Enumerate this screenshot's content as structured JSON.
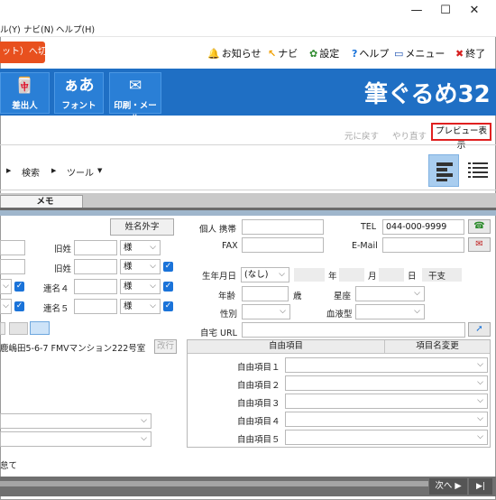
{
  "window": {
    "minimize": "—",
    "maximize": "☐",
    "close": "✕"
  },
  "menu": {
    "items": [
      "ル(Y)",
      "ナビ(N)",
      "ヘルプ(H)"
    ]
  },
  "toolbar": {
    "switch_button": "ット）へ切替",
    "links": [
      {
        "icon": "🔔",
        "label": "お知らせ"
      },
      {
        "icon": "↖",
        "label": "ナビ"
      },
      {
        "icon": "✿",
        "label": "設定"
      },
      {
        "icon": "?",
        "label": "ヘルプ"
      },
      {
        "icon": "▭",
        "label": "メニュー"
      },
      {
        "icon": "✖",
        "label": "終了"
      }
    ]
  },
  "ribbon": {
    "buttons": [
      {
        "label": "差出人",
        "glyph": "🀄"
      },
      {
        "label": "フォント",
        "glyph": "ぁあ"
      },
      {
        "label": "印刷・メール",
        "glyph": "✉"
      }
    ],
    "brand": "筆ぐるめ32"
  },
  "actions": {
    "undo": "元に戻す",
    "redo": "やり直す",
    "preview": "プレビュー表示"
  },
  "nav": {
    "search": "検索",
    "tools": "ツール"
  },
  "tabs": {
    "memo": "メモ"
  },
  "left": {
    "gaiji_button": "姓名外字",
    "kyusei1": "旧姓",
    "kyusei2": "旧姓",
    "rename4": "連名４",
    "rename5": "連名５",
    "sama": "様",
    "address": "鹿嶋田5-6-7  FMVマンション222号室",
    "kaigyo": "改行",
    "bottom_text": "怠て"
  },
  "right": {
    "personal_mobile_label": "個人 携帯",
    "fax_label": "FAX",
    "tel_label": "TEL",
    "tel_value": "044-000-9999",
    "email_label": "E-Mail",
    "birthday_label": "生年月日",
    "birthday_value": "(なし)",
    "year": "年",
    "month": "月",
    "day": "日",
    "eto": "干支",
    "age_label": "年齢",
    "age_unit": "歳",
    "zodiac_label": "星座",
    "gender_label": "性別",
    "blood_label": "血液型",
    "home_url_label": "自宅 URL",
    "free_header": "自由項目",
    "rename_header": "項目名変更",
    "free_items": [
      "自由項目１",
      "自由項目２",
      "自由項目３",
      "自由項目４",
      "自由項目５"
    ]
  },
  "footer": {
    "next": "次へ ▶",
    "end": "▶|"
  },
  "colors": {
    "accent_blue": "#1f6fc4",
    "orange": "#e8501e",
    "highlight_red": "#e02020",
    "checkbox_blue": "#1a73d9"
  }
}
